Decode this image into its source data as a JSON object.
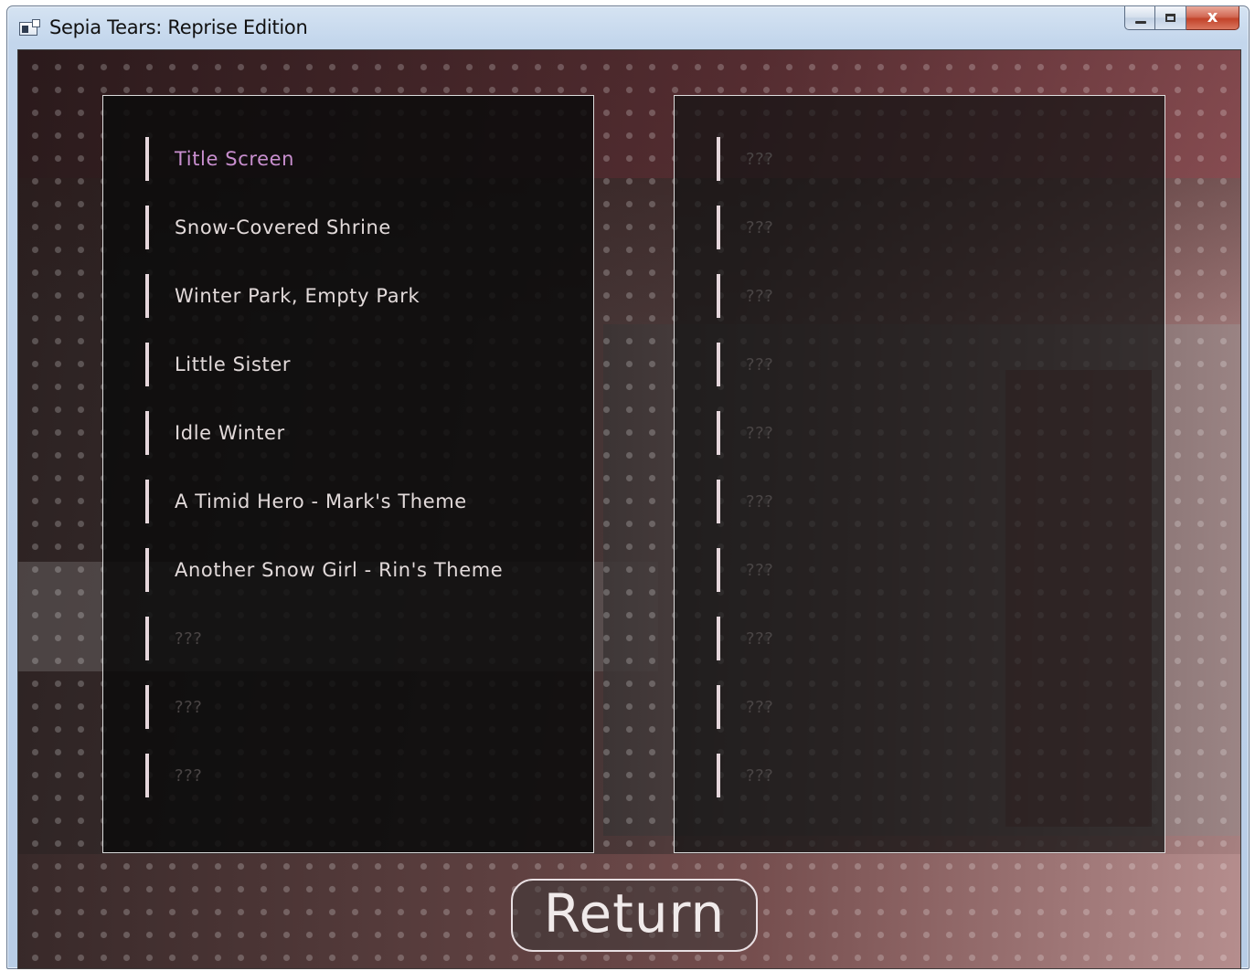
{
  "window": {
    "title": "Sepia Tears: Reprise Edition",
    "close_glyph": "x"
  },
  "music_room": {
    "left_tracks": [
      {
        "label": "Title Screen",
        "state": "selected"
      },
      {
        "label": "Snow-Covered Shrine",
        "state": "unlocked"
      },
      {
        "label": "Winter Park, Empty Park",
        "state": "unlocked"
      },
      {
        "label": "Little Sister",
        "state": "unlocked"
      },
      {
        "label": "Idle Winter",
        "state": "unlocked"
      },
      {
        "label": "A Timid Hero - Mark's Theme",
        "state": "unlocked"
      },
      {
        "label": "Another Snow Girl - Rin's Theme",
        "state": "unlocked"
      },
      {
        "label": "???",
        "state": "locked"
      },
      {
        "label": "???",
        "state": "locked"
      },
      {
        "label": "???",
        "state": "locked"
      }
    ],
    "right_tracks": [
      {
        "label": "???",
        "state": "locked"
      },
      {
        "label": "???",
        "state": "locked"
      },
      {
        "label": "???",
        "state": "locked"
      },
      {
        "label": "???",
        "state": "locked"
      },
      {
        "label": "???",
        "state": "locked"
      },
      {
        "label": "???",
        "state": "locked"
      },
      {
        "label": "???",
        "state": "locked"
      },
      {
        "label": "???",
        "state": "locked"
      },
      {
        "label": "???",
        "state": "locked"
      },
      {
        "label": "???",
        "state": "locked"
      }
    ],
    "return_label": "Return"
  },
  "colors": {
    "selected_track": "#c98fcf",
    "unlocked_track": "#e2dada",
    "locked_track": "#4a4545"
  }
}
